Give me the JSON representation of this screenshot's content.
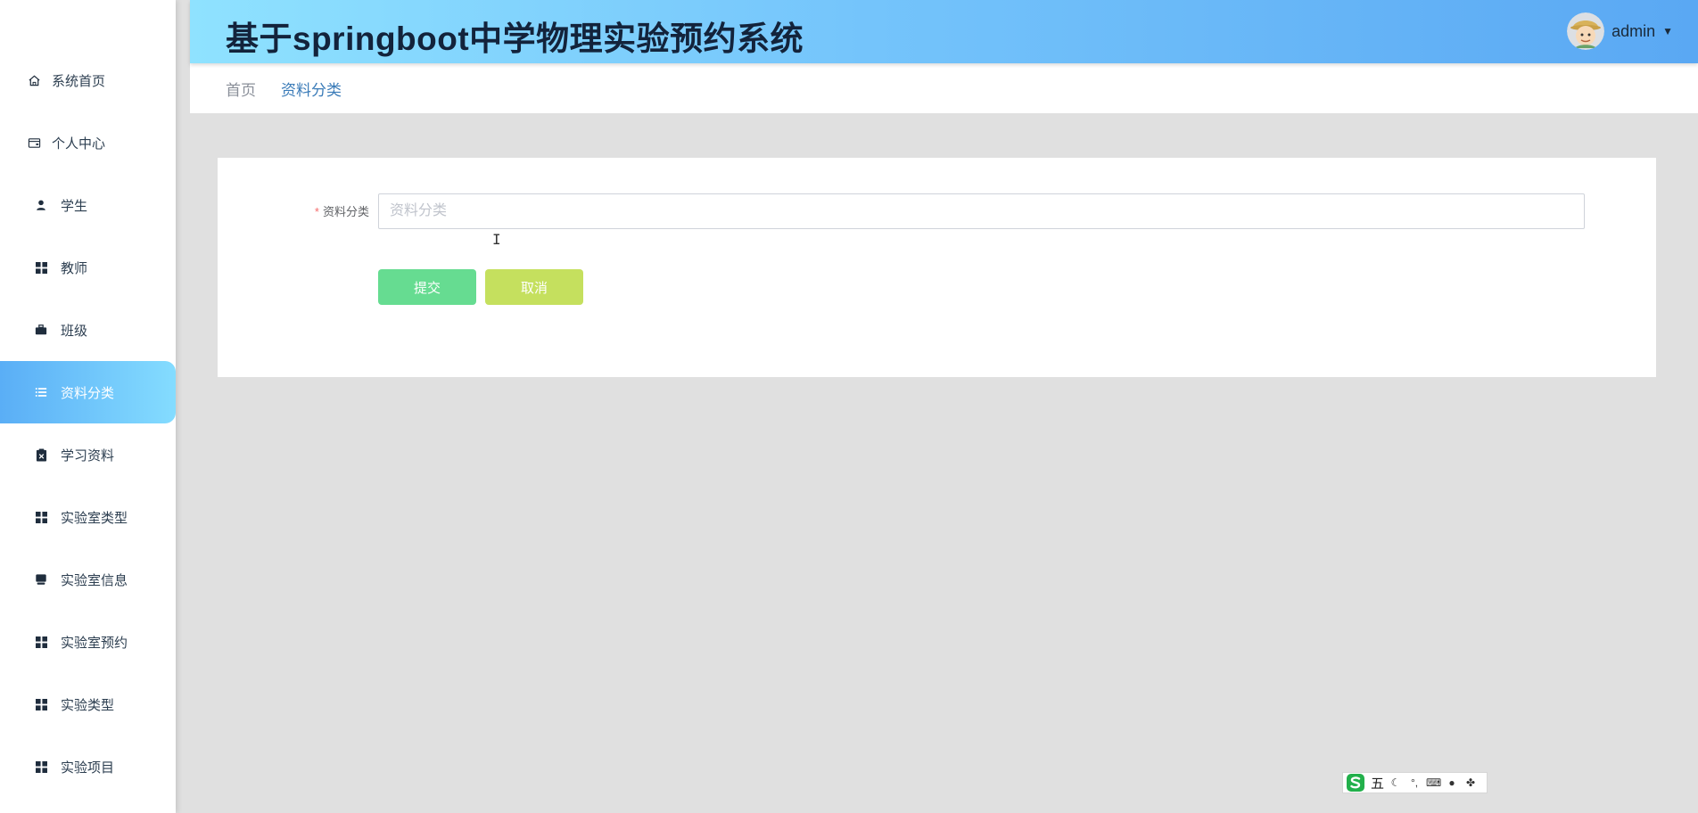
{
  "app": {
    "title": "基于springboot中学物理实验预约系统"
  },
  "user": {
    "name": "admin"
  },
  "sidebar": {
    "items": [
      {
        "label": "系统首页",
        "icon": "home-icon"
      },
      {
        "label": "个人中心",
        "icon": "wallet-icon"
      },
      {
        "label": "学生",
        "icon": "user-icon"
      },
      {
        "label": "教师",
        "icon": "grid-icon"
      },
      {
        "label": "班级",
        "icon": "briefcase-icon"
      },
      {
        "label": "资料分类",
        "icon": "list-icon",
        "active": true
      },
      {
        "label": "学习资料",
        "icon": "clipboard-icon"
      },
      {
        "label": "实验室类型",
        "icon": "grid-icon"
      },
      {
        "label": "实验室信息",
        "icon": "monitor-icon"
      },
      {
        "label": "实验室预约",
        "icon": "grid-icon"
      },
      {
        "label": "实验类型",
        "icon": "grid-icon"
      },
      {
        "label": "实验项目",
        "icon": "grid-icon"
      }
    ]
  },
  "breadcrumb": {
    "home": "首页",
    "current": "资料分类"
  },
  "form": {
    "field_label": "资料分类",
    "required_mark": "*",
    "field_value": "",
    "field_placeholder": "资料分类",
    "submit_label": "提交",
    "cancel_label": "取消"
  },
  "ime": {
    "mode": "五"
  },
  "colors": {
    "header_gradient_start": "#8fe2ff",
    "header_gradient_end": "#5aa8f3",
    "active_menu_start": "#5aaef6",
    "active_menu_end": "#84dcff",
    "submit_button": "#66dc91",
    "cancel_button": "#c5e05e",
    "content_bg": "#e0e0e0"
  }
}
